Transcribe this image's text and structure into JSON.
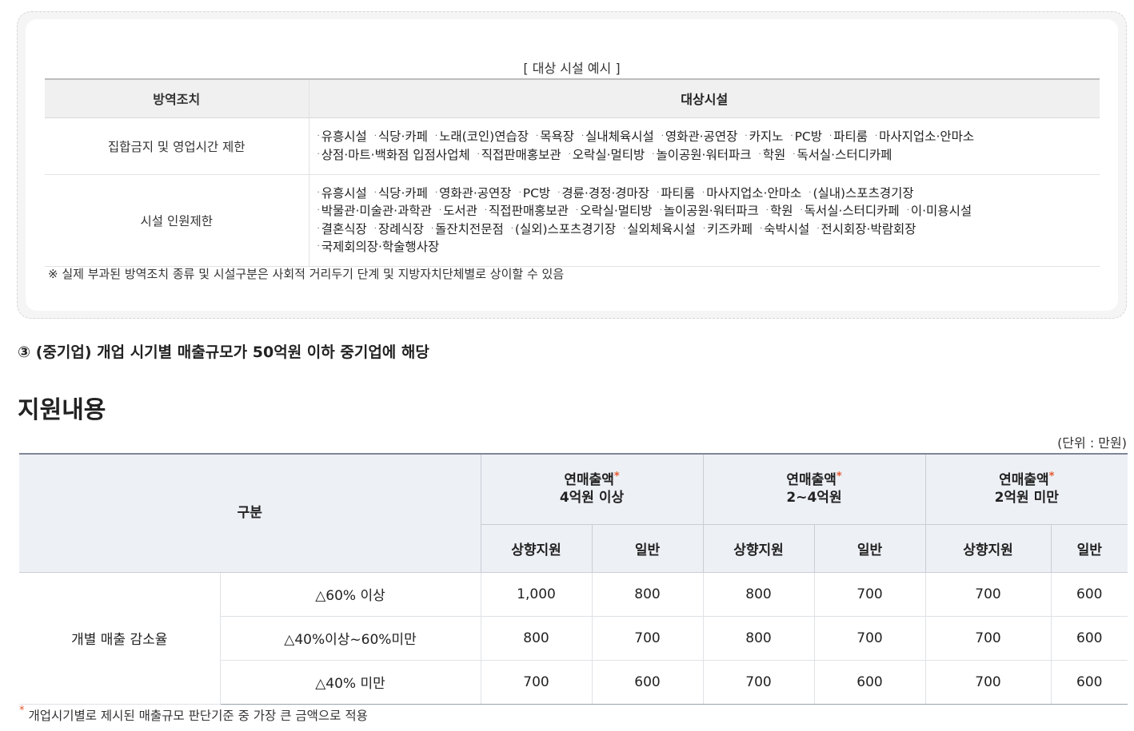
{
  "facility": {
    "caption": "[ 대상 시설 예시 ]",
    "col1": "방역조치",
    "col2": "대상시설",
    "rows": [
      {
        "measure": "집합금지 및 영업시간 제한",
        "lines": [
          [
            "유흥시설",
            "식당·카페",
            "노래(코인)연습장",
            "목욕장",
            "실내체육시설",
            "영화관·공연장",
            "카지노",
            "PC방",
            "파티룸",
            "마사지업소·안마소"
          ],
          [
            "상점·마트·백화점 입점사업체",
            "직접판매홍보관",
            "오락실·멀티방",
            "놀이공원·워터파크",
            "학원",
            "독서실·스터디카페"
          ]
        ]
      },
      {
        "measure": "시설 인원제한",
        "lines": [
          [
            "유흥시설",
            "식당·카페",
            "영화관·공연장",
            "PC방",
            "경륜·경정·경마장",
            "파티룸",
            "마사지업소·안마소",
            "(실내)스포츠경기장"
          ],
          [
            "박물관·미술관·과학관",
            "도서관",
            "직접판매홍보관",
            "오락실·멀티방",
            "놀이공원·워터파크",
            "학원",
            "독서실·스터디카페",
            "이·미용시설"
          ],
          [
            "결혼식장",
            "장례식장",
            "돌잔치전문점",
            "(실외)스포츠경기장",
            "실외체육시설",
            "키즈카페",
            "숙박시설",
            "전시회장·박람회장"
          ],
          [
            "국제회의장·학술행사장"
          ]
        ]
      }
    ],
    "note": "※ 실제 부과된 방역조치 종류 및 시설구분은 사회적 거리두기 단계 및 지방자치단체별로 상이할 수 있음"
  },
  "sub_heading": "③ (중기업) 개업 시기별 매출규모가 50억원 이하 중기업에 해당",
  "main_heading": "지원내용",
  "unit": "(단위 : 만원)",
  "support": {
    "category_header": "구분",
    "groups": [
      {
        "line1": "연매출액",
        "line2": "4억원 이상"
      },
      {
        "line1": "연매출액",
        "line2": "2~4억원"
      },
      {
        "line1": "연매출액",
        "line2": "2억원 미만"
      }
    ],
    "sub_headers": [
      "상향지원",
      "일반"
    ],
    "star": "*",
    "row_group_label": "개별 매출 감소율",
    "rows": [
      {
        "label": "△60% 이상",
        "values": [
          "1,000",
          "800",
          "800",
          "700",
          "700",
          "600"
        ]
      },
      {
        "label": "△40%이상~60%미만",
        "values": [
          "800",
          "700",
          "800",
          "700",
          "700",
          "600"
        ]
      },
      {
        "label": "△40% 미만",
        "values": [
          "700",
          "600",
          "700",
          "600",
          "700",
          "600"
        ]
      }
    ],
    "footnote": "개업시기별로 제시된 매출규모 판단기준 중 가장 큰 금액으로 적용"
  },
  "colors": {
    "star": "#e4572e",
    "table_header_bg": "#edf0f5",
    "facility_header_bg": "#f0f0f0"
  }
}
